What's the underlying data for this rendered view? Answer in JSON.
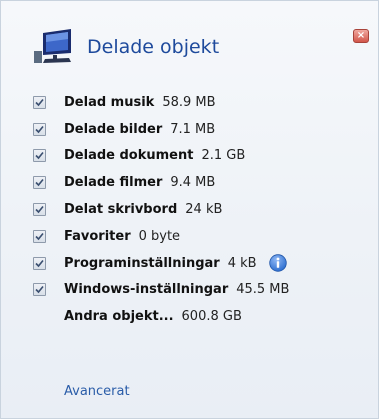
{
  "header": {
    "title": "Delade objekt",
    "close_glyph": "×"
  },
  "items": [
    {
      "label": "Delad musik",
      "size": "58.9 MB",
      "checked": true
    },
    {
      "label": "Delade bilder",
      "size": "7.1 MB",
      "checked": true
    },
    {
      "label": "Delade dokument",
      "size": "2.1 GB",
      "checked": true
    },
    {
      "label": "Delade filmer",
      "size": "9.4 MB",
      "checked": true
    },
    {
      "label": "Delat skrivbord",
      "size": "24 kB",
      "checked": true
    },
    {
      "label": "Favoriter",
      "size": "0 byte",
      "checked": true
    },
    {
      "label": "Programinställningar",
      "size": "4 kB",
      "checked": true,
      "icon": "info-icon"
    },
    {
      "label": "Windows-inställningar",
      "size": "45.5 MB",
      "checked": true
    },
    {
      "label": "Andra objekt...",
      "size": "600.8 GB",
      "checked": false
    }
  ],
  "footer": {
    "advanced_link": "Avancerat"
  },
  "colors": {
    "title": "#1e4a9c",
    "link": "#2a5ca8",
    "info": "#2e6fd0"
  }
}
